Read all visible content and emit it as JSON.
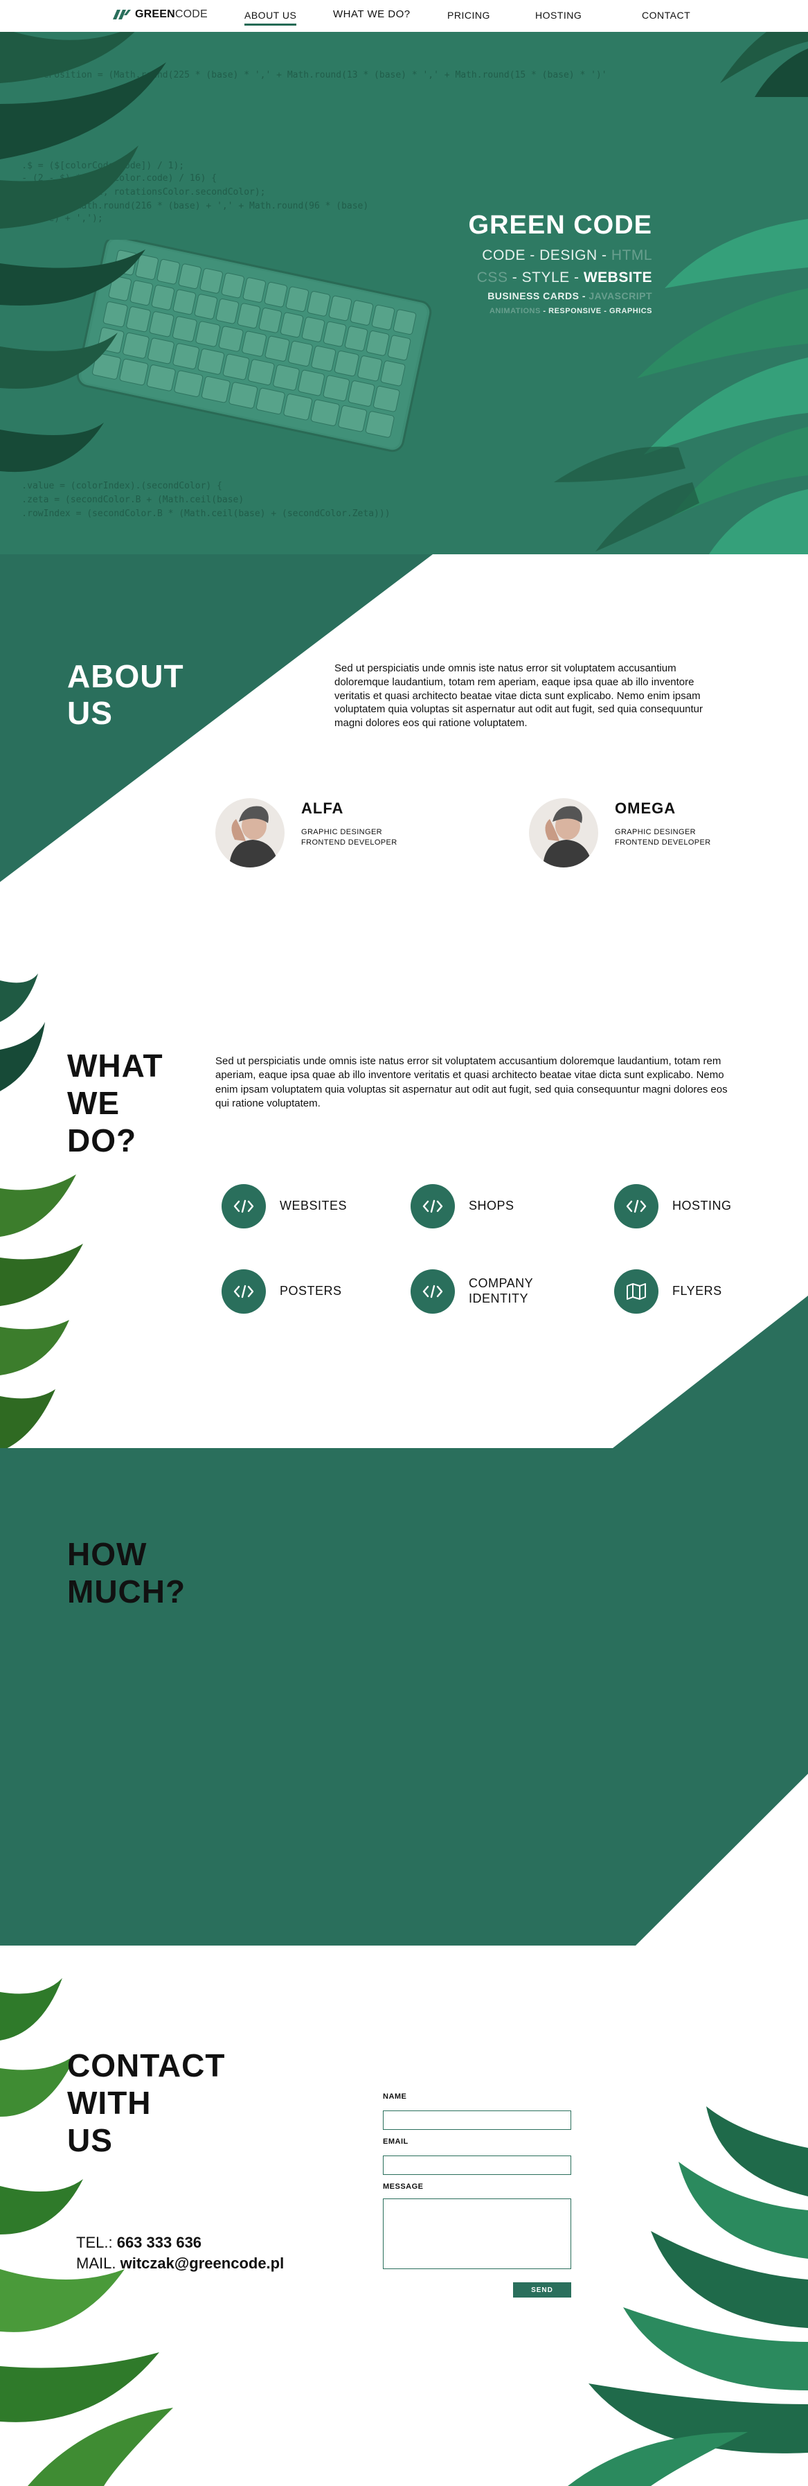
{
  "nav": {
    "logo_bold": "GREEN",
    "logo_light": "CODE",
    "items": [
      "ABOUT US",
      "WHAT WE DO?",
      "PRICING",
      "HOSTING",
      "CONTACT"
    ]
  },
  "hero": {
    "title": "GREEN CODE",
    "line1": [
      "CODE",
      " - ",
      "DESIGN",
      " - ",
      "HTML"
    ],
    "line2": [
      "CSS",
      " - ",
      "STYLE",
      " - ",
      "WEBSITE"
    ],
    "line3": [
      "BUSINESS CARDS",
      " - ",
      "JAVASCRIPT"
    ],
    "line4": [
      "ANIMATIONS",
      " - ",
      "RESPONSIVE",
      " - ",
      "GRAPHICS"
    ],
    "code_lines": [
      "    .movePosition = (Math.round(225 * (base) * ',' + Math.round(13 * (base) * ',' + Math.round(15 * (base) * ')'",
      "    .$ = ($[colorCode.code]) / 1);",
      "    - (2 - $) * (BaseColor.code) / 16) {",
      "    .transform(Init, rotationsColor.secondColor);",
      "    .color = (Math.round(216 * (base) + ',' + Math.round(96 * (base)",
      "    .(base) + ',');",
      "    .value = (colorIndex).(secondColor) {",
      "    .zeta = (secondColor.B + (Math.ceil(base)",
      "    .rowIndex = (secondColor.B * (Math.ceil(base) + (secondColor.Zeta)))"
    ]
  },
  "about": {
    "title_lines": [
      "ABOUT",
      "US"
    ],
    "text": "Sed ut perspiciatis unde omnis iste natus error sit voluptatem accusantium doloremque laudantium, totam rem aperiam, eaque ipsa quae ab illo inventore veritatis et quasi architecto beatae vitae dicta sunt explicabo. Nemo enim ipsam voluptatem quia voluptas sit aspernatur aut odit aut fugit, sed quia consequuntur magni dolores eos qui ratione voluptatem.",
    "members": [
      {
        "name": "ALFA",
        "role1": "GRAPHIC DESINGER",
        "role2": "FRONTEND DEVELOPER"
      },
      {
        "name": "OMEGA",
        "role1": "GRAPHIC DESINGER",
        "role2": "FRONTEND DEVELOPER"
      }
    ]
  },
  "what": {
    "title_lines": [
      "WHAT",
      "WE",
      "DO?"
    ],
    "text": "Sed ut perspiciatis unde omnis iste natus error sit voluptatem accusantium doloremque laudantium, totam rem aperiam, eaque ipsa quae ab illo inventore veritatis et quasi architecto beatae vitae dicta sunt explicabo. Nemo enim ipsam voluptatem quia voluptas sit aspernatur aut odit aut fugit, sed quia consequuntur magni dolores eos qui ratione voluptatem.",
    "services": [
      {
        "label": "WEBSITES",
        "icon": "code-icon"
      },
      {
        "label": "SHOPS",
        "icon": "code-icon"
      },
      {
        "label": "HOSTING",
        "icon": "code-icon"
      },
      {
        "label": "POSTERS",
        "icon": "code-icon"
      },
      {
        "label": "COMPANY IDENTITY",
        "icon": "code-icon"
      },
      {
        "label": "FLYERS",
        "icon": "map-icon"
      }
    ]
  },
  "how": {
    "title_lines": [
      "HOW",
      "MUCH?"
    ]
  },
  "contact": {
    "title_lines": [
      "CONTACT",
      "WITH",
      "US"
    ],
    "tel_label": "TEL.:",
    "tel_value": "663 333 636",
    "mail_label": "MAIL.",
    "mail_value": "witczak@greencode.pl",
    "form": {
      "name_label": "NAME",
      "email_label": "EMAIL",
      "message_label": "MESSAGE",
      "send_label": "SEND"
    }
  },
  "colors": {
    "brand_green": "#2a6f5c",
    "hero_green": "#2e7a63",
    "leaf_dark": "#1f5a43",
    "leaf_light": "#2c8a63"
  }
}
